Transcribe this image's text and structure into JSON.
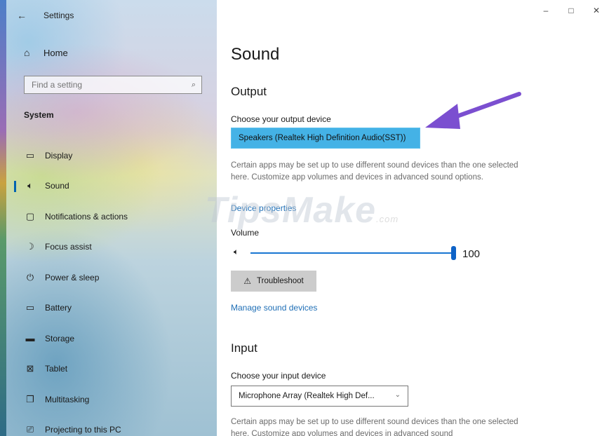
{
  "window": {
    "title": "Settings",
    "minimize": "–",
    "maximize": "□",
    "close": "✕"
  },
  "sidebar": {
    "back_glyph": "←",
    "home_label": "Home",
    "search_placeholder": "Find a setting",
    "section_label": "System",
    "items": [
      {
        "label": "Display",
        "icon": "display-icon",
        "glyph": "▭",
        "active": false
      },
      {
        "label": "Sound",
        "icon": "speaker-icon",
        "glyph": "🔈",
        "active": true
      },
      {
        "label": "Notifications & actions",
        "icon": "notification-icon",
        "glyph": "▢",
        "active": false
      },
      {
        "label": "Focus assist",
        "icon": "moon-icon",
        "glyph": "☽",
        "active": false
      },
      {
        "label": "Power & sleep",
        "icon": "power-icon",
        "glyph": "⏻",
        "active": false
      },
      {
        "label": "Battery",
        "icon": "battery-icon",
        "glyph": "▭",
        "active": false
      },
      {
        "label": "Storage",
        "icon": "storage-icon",
        "glyph": "▬",
        "active": false
      },
      {
        "label": "Tablet",
        "icon": "tablet-icon",
        "glyph": "⊠",
        "active": false
      },
      {
        "label": "Multitasking",
        "icon": "multitasking-icon",
        "glyph": "❐",
        "active": false
      },
      {
        "label": "Projecting to this PC",
        "icon": "projecting-icon",
        "glyph": "⎚",
        "active": false
      }
    ]
  },
  "main": {
    "page_title": "Sound",
    "output": {
      "heading": "Output",
      "device_label": "Choose your output device",
      "device_value": "Speakers (Realtek High Definition Audio(SST))",
      "description": "Certain apps may be set up to use different sound devices than the one selected here. Customize app volumes and devices in advanced sound options.",
      "device_properties_link": "Device properties",
      "volume_label": "Volume",
      "volume_value": "100",
      "troubleshoot_label": "Troubleshoot",
      "manage_link": "Manage sound devices"
    },
    "input": {
      "heading": "Input",
      "device_label": "Choose your input device",
      "device_value": "Microphone Array (Realtek High Def...",
      "description": "Certain apps may be set up to use different sound devices than the one selected here. Customize app volumes and devices in advanced sound"
    }
  },
  "watermark": {
    "brand": "TipsMake",
    "suffix": ".com"
  },
  "colors": {
    "accent": "#0063b1",
    "device_highlight": "#44b2e6",
    "arrow": "#7b4fd0",
    "link": "#1f6fb6"
  }
}
